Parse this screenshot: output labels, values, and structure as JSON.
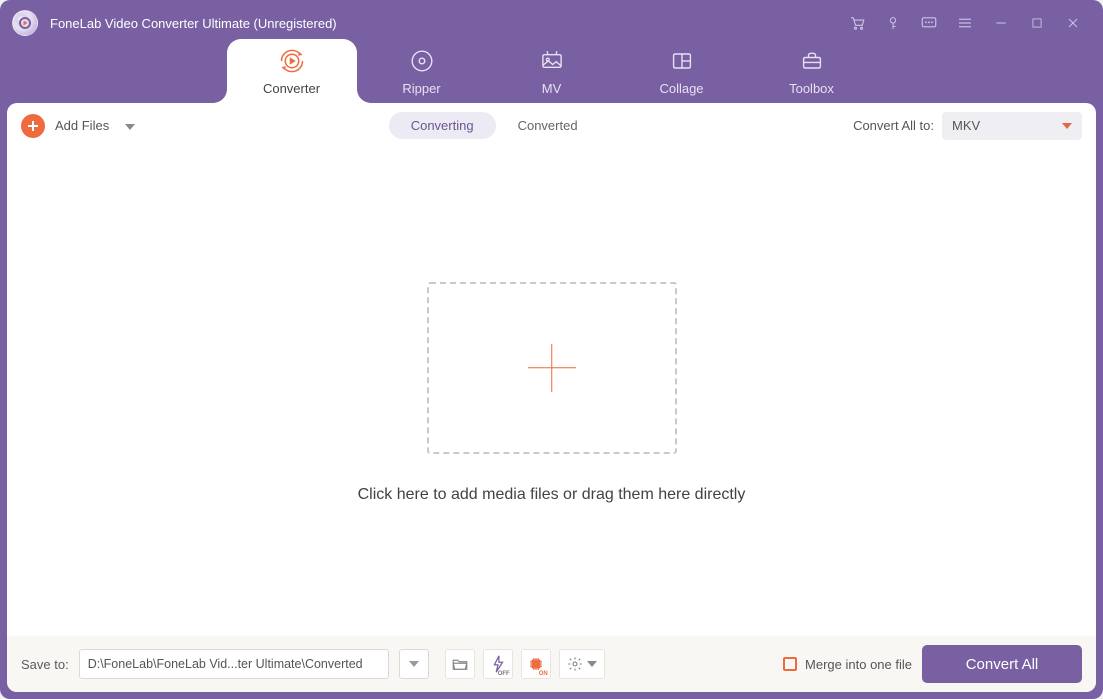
{
  "title": "FoneLab Video Converter Ultimate (Unregistered)",
  "tabs": {
    "converter": "Converter",
    "ripper": "Ripper",
    "mv": "MV",
    "collage": "Collage",
    "toolbox": "Toolbox"
  },
  "toolbar": {
    "add_files": "Add Files",
    "converting": "Converting",
    "converted": "Converted",
    "convert_all_to": "Convert All to:",
    "format_selected": "MKV"
  },
  "dropzone": {
    "hint": "Click here to add media files or drag them here directly"
  },
  "bottom": {
    "save_to": "Save to:",
    "path": "D:\\FoneLab\\FoneLab Vid...ter Ultimate\\Converted",
    "hw_toggle_label": "OFF",
    "gpu_toggle_label": "ON",
    "merge": "Merge into one file",
    "convert_all": "Convert All"
  }
}
